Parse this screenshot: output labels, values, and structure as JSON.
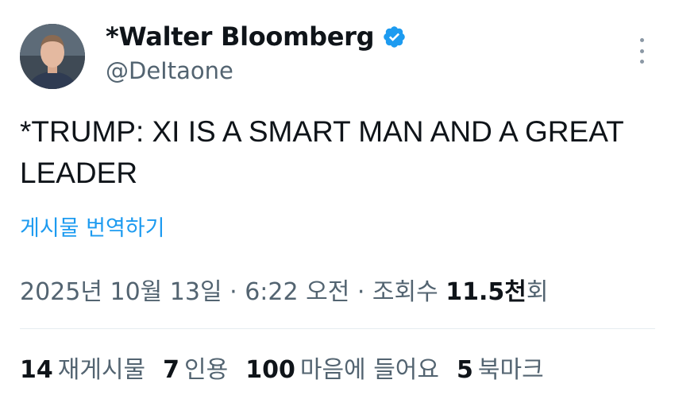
{
  "author": {
    "display_name": "*Walter Bloomberg",
    "handle": "@DeItaone",
    "verified_color": "#1d9bf0"
  },
  "tweet": {
    "text": "*TRUMP: XI IS A SMART MAN AND A GREAT LEADER",
    "translate_label": "게시물 번역하기"
  },
  "meta": {
    "date": "2025년 10월 13일",
    "separator": " · ",
    "time": "6:22 오전",
    "views_label": "조회수",
    "views_num": "11.5천",
    "views_suffix": "회"
  },
  "stats": {
    "reposts": {
      "count": "14",
      "label": "재게시물"
    },
    "quotes": {
      "count": "7",
      "label": "인용"
    },
    "likes": {
      "count": "100",
      "label": "마음에 들어요"
    },
    "bookmarks": {
      "count": "5",
      "label": "북마크"
    }
  },
  "icons": {
    "verified": "verified-badge-icon",
    "more": "more-vertical-icon"
  }
}
